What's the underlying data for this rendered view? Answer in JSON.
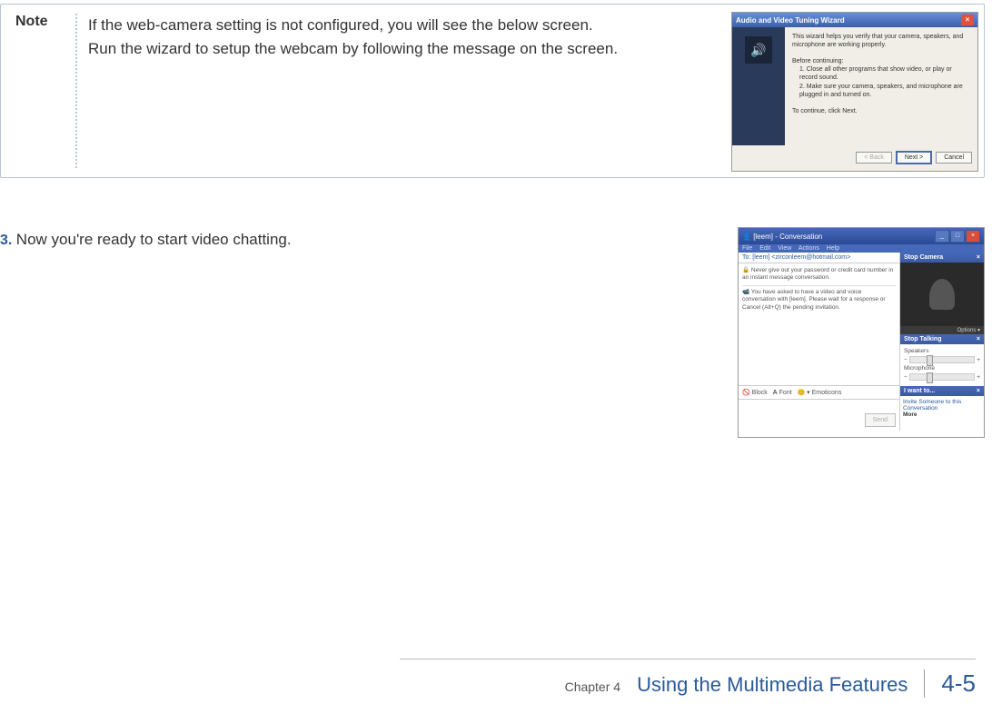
{
  "note": {
    "label": "Note",
    "line1": "If the web-camera setting is not configured, you will see the below screen.",
    "line2": "Run the wizard to setup the webcam by following the message on the screen."
  },
  "wizard": {
    "title": "Audio and Video Tuning Wizard",
    "intro": "This wizard helps you verify that your camera, speakers, and microphone are working properly.",
    "before": "Before continuing:",
    "item1": "1. Close all other programs that show video, or play or record sound.",
    "item2": "2. Make sure your camera, speakers, and microphone are plugged in and turned on.",
    "continue": "To continue, click Next.",
    "back": "< Back",
    "next": "Next >",
    "cancel": "Cancel"
  },
  "step": {
    "num": "3.",
    "text": "Now you're ready to start video chatting."
  },
  "chat": {
    "title": "[leem] - Conversation",
    "menu_file": "File",
    "menu_edit": "Edit",
    "menu_view": "View",
    "menu_actions": "Actions",
    "menu_help": "Help",
    "to": "To:   [leem] <zirconleem@hotmail.com>",
    "warn": "Never give out your password or credit card number in an instant message conversation.",
    "msg": "You have asked to have a video and voice conversation with [leem]. Please wait for a response or Cancel (Alt+Q) the pending invitation.",
    "block": "Block",
    "font": "Font",
    "emoticons": "Emoticons",
    "send": "Send",
    "stop_camera": "Stop Camera",
    "options": "Options ▾",
    "stop_talking": "Stop Talking",
    "speakers": "Speakers",
    "microphone": "Microphone",
    "iwantto": "I want to...",
    "invite": "Invite Someone to this Conversation",
    "more": "More"
  },
  "footer": {
    "chapter": "Chapter 4",
    "title": "Using the Multimedia Features",
    "page": "4-5"
  }
}
